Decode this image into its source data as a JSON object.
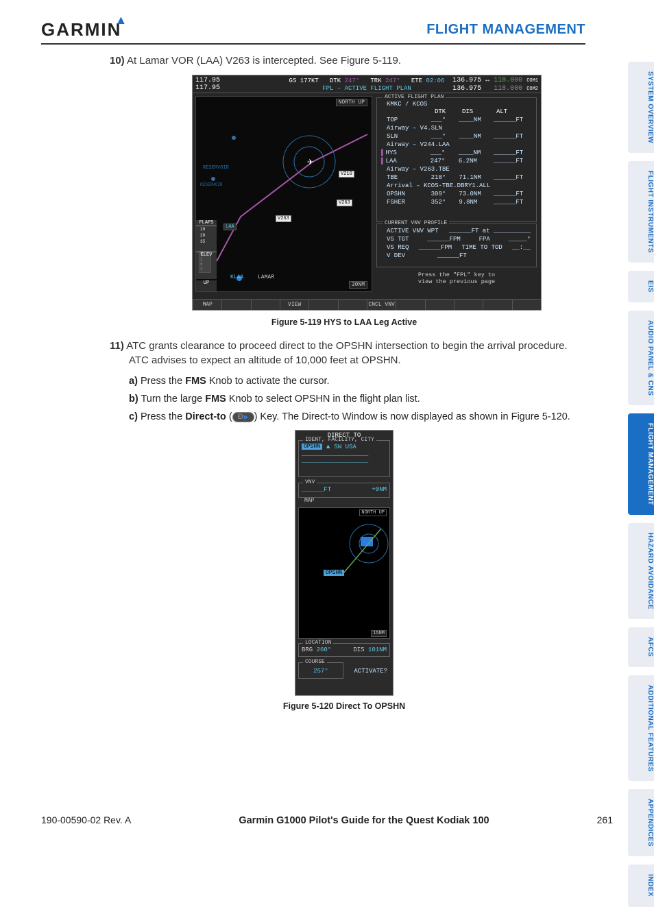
{
  "header": {
    "logo_text": "GARMIN",
    "section": "FLIGHT MANAGEMENT"
  },
  "tabs": [
    {
      "label": "SYSTEM OVERVIEW",
      "active": false
    },
    {
      "label": "FLIGHT INSTRUMENTS",
      "active": false
    },
    {
      "label": "EIS",
      "active": false
    },
    {
      "label": "AUDIO PANEL & CNS",
      "active": false
    },
    {
      "label": "FLIGHT MANAGEMENT",
      "active": true
    },
    {
      "label": "HAZARD AVOIDANCE",
      "active": false
    },
    {
      "label": "AFCS",
      "active": false
    },
    {
      "label": "ADDITIONAL FEATURES",
      "active": false
    },
    {
      "label": "APPENDICES",
      "active": false
    },
    {
      "label": "INDEX",
      "active": false
    }
  ],
  "steps": {
    "s10": {
      "num": "10)",
      "text": "At Lamar VOR (LAA) V263 is intercepted.  See Figure 5-119."
    },
    "s11": {
      "num": "11)",
      "text": "ATC grants clearance to proceed direct to the OPSHN intersection to begin the arrival procedure.  ATC advises to expect an altitude of 10,000 feet at  OPSHN.",
      "a": {
        "l": "a)",
        "pre": "Press the ",
        "b": "FMS",
        "post": " Knob to activate the cursor."
      },
      "b": {
        "l": "b)",
        "pre": "Turn the large ",
        "b": "FMS",
        "post": " Knob to select OPSHN in the flight plan list."
      },
      "c": {
        "l": "c)",
        "pre": "Press the ",
        "b": "Direct-to",
        "post1": " (",
        "post2": ") Key.  The Direct-to Window is now displayed as shown in Figure 5-120."
      }
    }
  },
  "figcaps": {
    "f1": "Figure 5-119  HYS to LAA Leg Active",
    "f2": "Figure 5-120  Direct To OPSHN"
  },
  "fig1": {
    "nav1": "117.95",
    "nav2": "117.95",
    "top_gs_l": "GS",
    "top_gs_v": "177KT",
    "top_dtk_l": "DTK",
    "top_dtk_v": "247°",
    "top_trk_l": "TRK",
    "top_trk_v": "247°",
    "top_ete_l": "ETE",
    "top_ete_v": "02:06",
    "title2": "FPL – ACTIVE FLIGHT PLAN",
    "com1a": "136.975",
    "com1b": "118.000",
    "com1s": "COM1",
    "com2a": "136.975",
    "com2b": "118.000",
    "com2s": "COM2",
    "north": "NORTH UP",
    "scale": "30NM",
    "map_labels": {
      "reservoir1": "RESERVOIR",
      "reservoir2": "RESERVOIR",
      "v210": "V210",
      "v263_a": "V263",
      "v263_b": "V263",
      "laa_box": "LAA",
      "klaa": "KLAA",
      "lamar": "LAMAR"
    },
    "flaps_hdr": "FLAPS",
    "flaps_10": "10",
    "flaps_20": "20",
    "flaps_35": "35",
    "elev_hdr": "ELEV",
    "elev_up": "UP",
    "plan_header": "ACTIVE FLIGHT PLAN",
    "plan_sub": "KMKC / KCOS",
    "cols": {
      "dtk": "DTK",
      "dis": "DIS",
      "alt": "ALT"
    },
    "rows": [
      {
        "l": "TOP",
        "dtk": "",
        "dis": "____NM",
        "alt": "______FT"
      },
      {
        "l": "Airway – V4.SLN",
        "full": true
      },
      {
        "l": "SLN",
        "dtk": "",
        "dis": "____NM",
        "alt": "______FT"
      },
      {
        "l": "Airway – V244.LAA",
        "full": true
      },
      {
        "l": "HYS",
        "dtk": "",
        "dis": "____NM",
        "alt": "______FT",
        "leg": true
      },
      {
        "l": "LAA",
        "dtk": "247°",
        "dis": "6.2NM",
        "alt": "______FT",
        "leg": true
      },
      {
        "l": "Airway – V263.TBE",
        "full": true
      },
      {
        "l": "TBE",
        "dtk": "218°",
        "dis": "71.1NM",
        "alt": "______FT"
      },
      {
        "l": "Arrival – KCOS-TBE.DBRY1.ALL",
        "full": true
      },
      {
        "l": "OPSHN",
        "dtk": "309°",
        "dis": "73.0NM",
        "alt": "______FT"
      },
      {
        "l": "FSHER",
        "dtk": "352°",
        "dis": "9.8NM",
        "alt": "______FT"
      }
    ],
    "vnv_hdr": "CURRENT VNV PROFILE",
    "vnv": {
      "r1a": "ACTIVE VNV WPT",
      "r1b": "______FT at __________",
      "r2a": "VS TGT",
      "r2b": "______FPM",
      "r2c": "FPA",
      "r2d": "_____°",
      "r3a": "VS REQ",
      "r3b": "______FPM",
      "r3c": "TIME TO TOD",
      "r3d": "__:__",
      "r4a": "V DEV",
      "r4b": "______FT"
    },
    "hint1": "Press the \"FPL\" key to",
    "hint2": "view the previous page",
    "softkeys": [
      "MAP",
      "",
      "",
      "VIEW",
      "",
      "",
      "CNCL VNV",
      "",
      "",
      "",
      "",
      ""
    ]
  },
  "fig2": {
    "title": "DIRECT TO",
    "ident_hdr": "IDENT, FACILITY, CITY",
    "ident": "OPSHN",
    "region": "SW USA",
    "dash1": "__________________",
    "dash2": "__________________",
    "vnv_hdr": "VNV",
    "vnv_ft": "______FT",
    "vnv_off": "+0NM",
    "map_hdr": "MAP",
    "north": "NORTH UP",
    "scale": "15NM",
    "opshn_chip": "OPSHN",
    "loc_hdr": "LOCATION",
    "brg_l": "BRG",
    "brg_v": "260°",
    "dis_l": "DIS",
    "dis_v": "101NM",
    "crs_hdr": "COURSE",
    "crs_v": "257°",
    "activate": "ACTIVATE?"
  },
  "footer": {
    "left": "190-00590-02  Rev. A",
    "mid": "Garmin G1000 Pilot's Guide for the Quest Kodiak 100",
    "right": "261"
  }
}
